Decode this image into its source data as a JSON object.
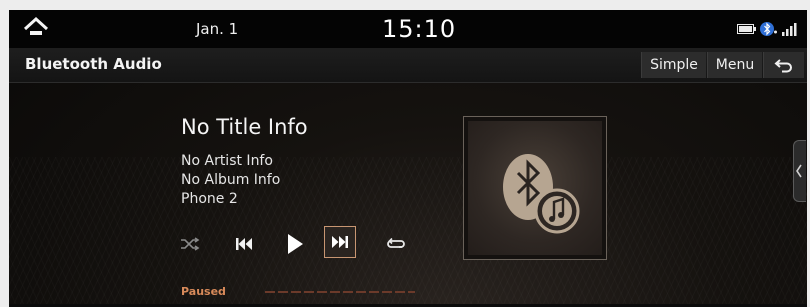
{
  "status_bar": {
    "date": "Jan. 1",
    "time": "15:10",
    "icons": [
      "home-icon",
      "battery-icon",
      "bluetooth-icon",
      "signal-icon"
    ]
  },
  "header": {
    "title": "Bluetooth Audio",
    "simple_label": "Simple",
    "menu_label": "Menu",
    "back_icon": "back-arrow-icon"
  },
  "track": {
    "title": "No Title Info",
    "artist": "No Artist Info",
    "album": "No Album Info",
    "device": "Phone 2"
  },
  "controls": [
    "shuffle-icon",
    "previous-icon",
    "play-icon",
    "next-icon",
    "repeat-icon"
  ],
  "playback": {
    "status": "Paused",
    "progress": 0
  },
  "colors": {
    "accent": "#d88a5a",
    "background": "#0a0908",
    "text": "#f5f5f5"
  }
}
